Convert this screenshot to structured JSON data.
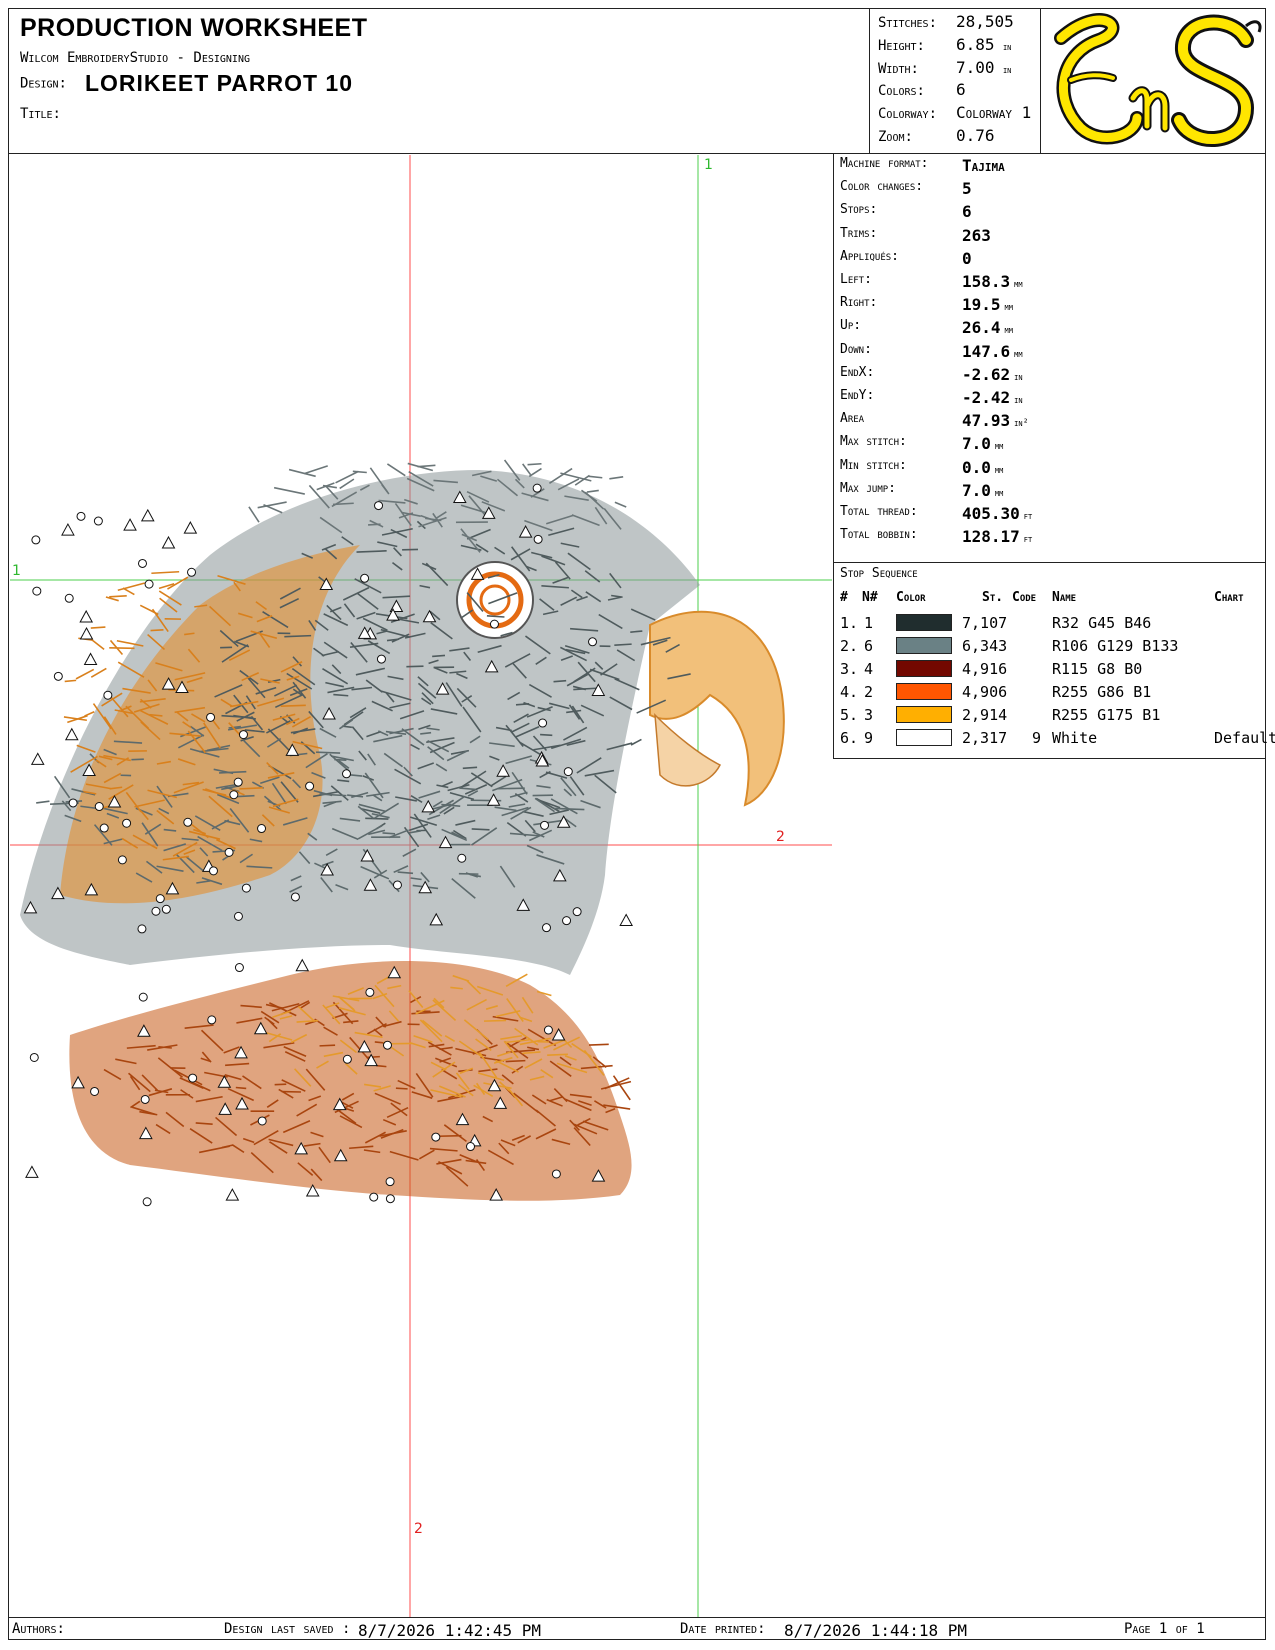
{
  "header": {
    "title": "PRODUCTION WORKSHEET",
    "software": "Wilcom EmbroideryStudio - Designing",
    "design_label": "Design:",
    "design_name": "LORIKEET PARROT  10",
    "title_label": "Title:"
  },
  "summary": [
    {
      "label": "Stitches:",
      "value": "28,505",
      "unit": ""
    },
    {
      "label": "Height:",
      "value": "6.85",
      "unit": "in"
    },
    {
      "label": "Width:",
      "value": "7.00",
      "unit": "in"
    },
    {
      "label": "Colors:",
      "value": "6",
      "unit": ""
    },
    {
      "label": "Colorway:",
      "value": "Colorway 1",
      "unit": ""
    },
    {
      "label": "Zoom:",
      "value": "0.76",
      "unit": ""
    }
  ],
  "logo": {
    "text": "EnS",
    "colors": {
      "fill": "#FFE600",
      "stroke": "#111111"
    }
  },
  "stats": [
    {
      "label": "Machine format:",
      "value": "Tajima",
      "unit": ""
    },
    {
      "label": "Color changes:",
      "value": "5",
      "unit": ""
    },
    {
      "label": "Stops:",
      "value": "6",
      "unit": ""
    },
    {
      "label": "Trims:",
      "value": "263",
      "unit": ""
    },
    {
      "label": "Appliqués:",
      "value": "0",
      "unit": ""
    },
    {
      "label": "Left:",
      "value": "158.3",
      "unit": "mm"
    },
    {
      "label": "Right:",
      "value": "19.5",
      "unit": "mm"
    },
    {
      "label": "Up:",
      "value": "26.4",
      "unit": "mm"
    },
    {
      "label": "Down:",
      "value": "147.6",
      "unit": "mm"
    },
    {
      "label": "EndX:",
      "value": "-2.62",
      "unit": "in"
    },
    {
      "label": "EndY:",
      "value": "-2.42",
      "unit": "in"
    },
    {
      "label": "Area",
      "value": "47.93",
      "unit": "in²"
    },
    {
      "label": "Max stitch:",
      "value": "7.0",
      "unit": "mm"
    },
    {
      "label": "Min stitch:",
      "value": "0.0",
      "unit": "mm"
    },
    {
      "label": "Max jump:",
      "value": "7.0",
      "unit": "mm"
    },
    {
      "label": "Total thread:",
      "value": "405.30",
      "unit": "ft"
    },
    {
      "label": "Total bobbin:",
      "value": "128.17",
      "unit": "ft"
    }
  ],
  "stop_sequence": {
    "title": "Stop Sequence",
    "columns": {
      "num": "#",
      "n": "N#",
      "color": "Color",
      "st": "St.",
      "code": "Code",
      "name": "Name",
      "chart": "Chart"
    },
    "rows": [
      {
        "num": "1.",
        "n": "1",
        "color": "#202D2E",
        "st": "7,107",
        "code": "",
        "name": "R32 G45 B46",
        "chart": ""
      },
      {
        "num": "2.",
        "n": "6",
        "color": "#6A8185",
        "st": "6,343",
        "code": "",
        "name": "R106 G129 B133",
        "chart": ""
      },
      {
        "num": "3.",
        "n": "4",
        "color": "#730800",
        "st": "4,916",
        "code": "",
        "name": "R115 G8 B0",
        "chart": ""
      },
      {
        "num": "4.",
        "n": "2",
        "color": "#FF5601",
        "st": "4,906",
        "code": "",
        "name": "R255 G86 B1",
        "chart": ""
      },
      {
        "num": "5.",
        "n": "3",
        "color": "#FFAF01",
        "st": "2,914",
        "code": "",
        "name": "R255 G175 B1",
        "chart": ""
      },
      {
        "num": "6.",
        "n": "9",
        "color": "#FFFFFF",
        "st": "2,317",
        "code": "9",
        "name": "White",
        "chart": "Default"
      }
    ]
  },
  "guides": {
    "h1": "1",
    "h2": "2",
    "v1": "1",
    "v2": "2"
  },
  "footer": {
    "authors_label": "Authors:",
    "saved_label": "Design last saved :",
    "saved_value": "8/7/2026 1:42:45 PM",
    "printed_label": "Date printed:",
    "printed_value": "8/7/2026 1:44:18 PM",
    "page": "Page 1 of 1"
  }
}
